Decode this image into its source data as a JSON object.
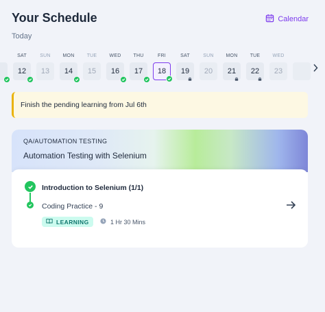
{
  "header": {
    "title": "Your Schedule",
    "calendar_label": "Calendar",
    "subtitle": "Today"
  },
  "strip": {
    "days": [
      {
        "dow": "",
        "date": "",
        "status": "completed",
        "muted": false,
        "partial": true
      },
      {
        "dow": "SAT",
        "date": "12",
        "status": "completed",
        "muted": false
      },
      {
        "dow": "SUN",
        "date": "13",
        "status": "none",
        "muted": true
      },
      {
        "dow": "MON",
        "date": "14",
        "status": "completed",
        "muted": false
      },
      {
        "dow": "TUE",
        "date": "15",
        "status": "none",
        "muted": true
      },
      {
        "dow": "WED",
        "date": "16",
        "status": "completed",
        "muted": false
      },
      {
        "dow": "THU",
        "date": "17",
        "status": "completed",
        "muted": false
      },
      {
        "dow": "FRI",
        "date": "18",
        "status": "completed",
        "muted": false,
        "selected": true
      },
      {
        "dow": "SAT",
        "date": "19",
        "status": "locked",
        "muted": false
      },
      {
        "dow": "SUN",
        "date": "20",
        "status": "none",
        "muted": true
      },
      {
        "dow": "MON",
        "date": "21",
        "status": "locked",
        "muted": false
      },
      {
        "dow": "TUE",
        "date": "22",
        "status": "locked",
        "muted": false
      },
      {
        "dow": "WED",
        "date": "23",
        "status": "none",
        "muted": true
      },
      {
        "dow": "",
        "date": "",
        "status": "none",
        "muted": true,
        "partial": true
      }
    ]
  },
  "notice": {
    "text": "Finish the pending learning from Jul 6th"
  },
  "card": {
    "track": "QA/AUTOMATION TESTING",
    "course": "Automation Testing with Selenium",
    "module_title": "Introduction to Selenium (1/1)",
    "item_title": "Coding Practice - 9",
    "pill_label": "LEARNING",
    "duration": "1 Hr 30 Mins"
  },
  "colors": {
    "accent": "#7c3aed",
    "success": "#22c55e",
    "notice_border": "#eab308",
    "pill_bg": "#ccfbef",
    "pill_text": "#0f766e"
  }
}
